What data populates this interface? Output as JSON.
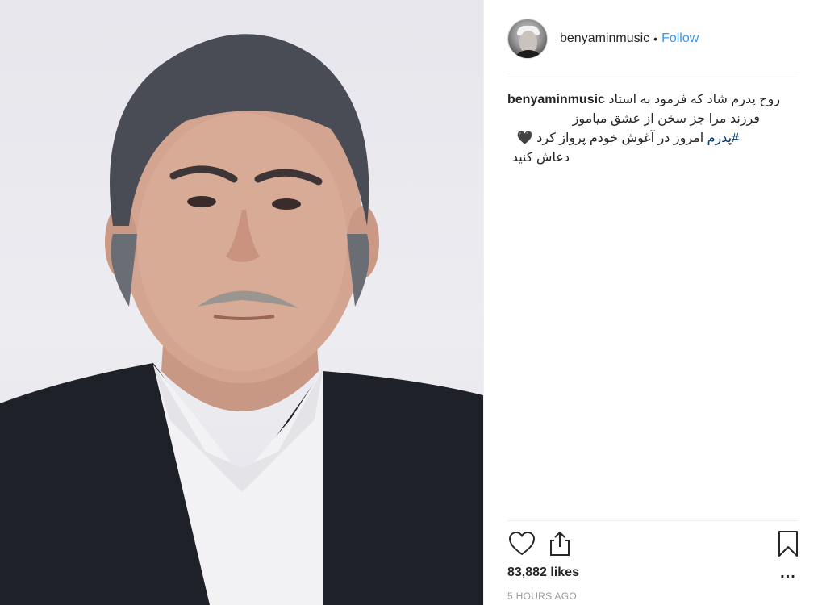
{
  "post": {
    "username": "benyaminmusic",
    "separator": "•",
    "follow_label": "Follow",
    "caption": {
      "username": "benyaminmusic",
      "line1_text": "روح پدرم شاد که فرمود به استاد",
      "line2_text": "فرزند مرا جز سخن از عشق میاموز",
      "line3_hashtag": "#پدرم",
      "line3_text": "امروز در آغوش خودم پرواز کرد",
      "line3_emoji": "🖤",
      "line4_text": "دعاش کنید"
    },
    "likes": "83,882 likes",
    "time": "5 HOURS AGO",
    "more_label": "..."
  },
  "icons": {
    "like": "heart-icon",
    "share": "share-icon",
    "save": "bookmark-icon",
    "more": "more-options-icon"
  },
  "colors": {
    "link_blue": "#3897f0",
    "hashtag": "#003569",
    "muted": "#999999",
    "text": "#262626",
    "divider": "#efefef"
  }
}
